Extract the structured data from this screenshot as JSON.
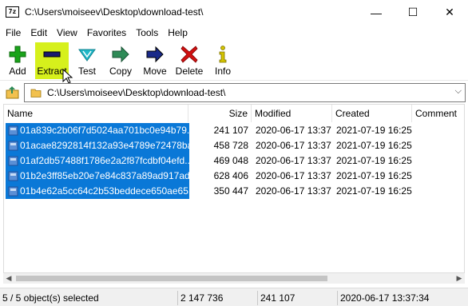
{
  "window": {
    "title": "C:\\Users\\moiseev\\Desktop\\download-test\\",
    "app_icon_text": "7z",
    "minimize": "—",
    "maximize": "☐",
    "close": "✕"
  },
  "menu": [
    "File",
    "Edit",
    "View",
    "Favorites",
    "Tools",
    "Help"
  ],
  "toolbar": {
    "buttons": [
      {
        "label": "Add",
        "icon": "plus-icon",
        "color": "#1aa31a"
      },
      {
        "label": "Extract",
        "icon": "minus-icon",
        "color": "#1a1a6e",
        "active": true
      },
      {
        "label": "Test",
        "icon": "check-icon",
        "color": "#1fb8c8"
      },
      {
        "label": "Copy",
        "icon": "copy-arrow-icon",
        "color": "#2e8b57"
      },
      {
        "label": "Move",
        "icon": "move-arrow-icon",
        "color": "#1a2a8a"
      },
      {
        "label": "Delete",
        "icon": "delete-x-icon",
        "color": "#d01010"
      },
      {
        "label": "Info",
        "icon": "info-icon",
        "color": "#d4c400"
      }
    ],
    "active_color": "#d6f01c"
  },
  "address": {
    "path": "C:\\Users\\moiseev\\Desktop\\download-test\\",
    "dropdown": "⌵"
  },
  "columns": {
    "name": "Name",
    "size": "Size",
    "modified": "Modified",
    "created": "Created",
    "comment": "Comment"
  },
  "files": [
    {
      "name": "01a839c2b06f7d5024aa701bc0e94b79...",
      "size": "241 107",
      "modified": "2020-06-17 13:37",
      "created": "2021-07-19 16:25"
    },
    {
      "name": "01acae8292814f132a93e4789e72478ba...",
      "size": "458 728",
      "modified": "2020-06-17 13:37",
      "created": "2021-07-19 16:25"
    },
    {
      "name": "01af2db57488f1786e2a2f87fcdbf04efd...",
      "size": "469 048",
      "modified": "2020-06-17 13:37",
      "created": "2021-07-19 16:25"
    },
    {
      "name": "01b2e3ff85eb20e7e84c837a89ad917ad...",
      "size": "628 406",
      "modified": "2020-06-17 13:37",
      "created": "2021-07-19 16:25"
    },
    {
      "name": "01b4e62a5cc64c2b53beddece650ae65...",
      "size": "350 447",
      "modified": "2020-06-17 13:37",
      "created": "2021-07-19 16:25"
    }
  ],
  "selection_color": "#0a78d7",
  "status": {
    "selected": "5 / 5 object(s) selected",
    "total_size": "2 147 736",
    "item_size": "241 107",
    "date": "2020-06-17 13:37:34"
  },
  "scrollbar": {
    "left_arrow": "◀",
    "right_arrow": "▶"
  }
}
